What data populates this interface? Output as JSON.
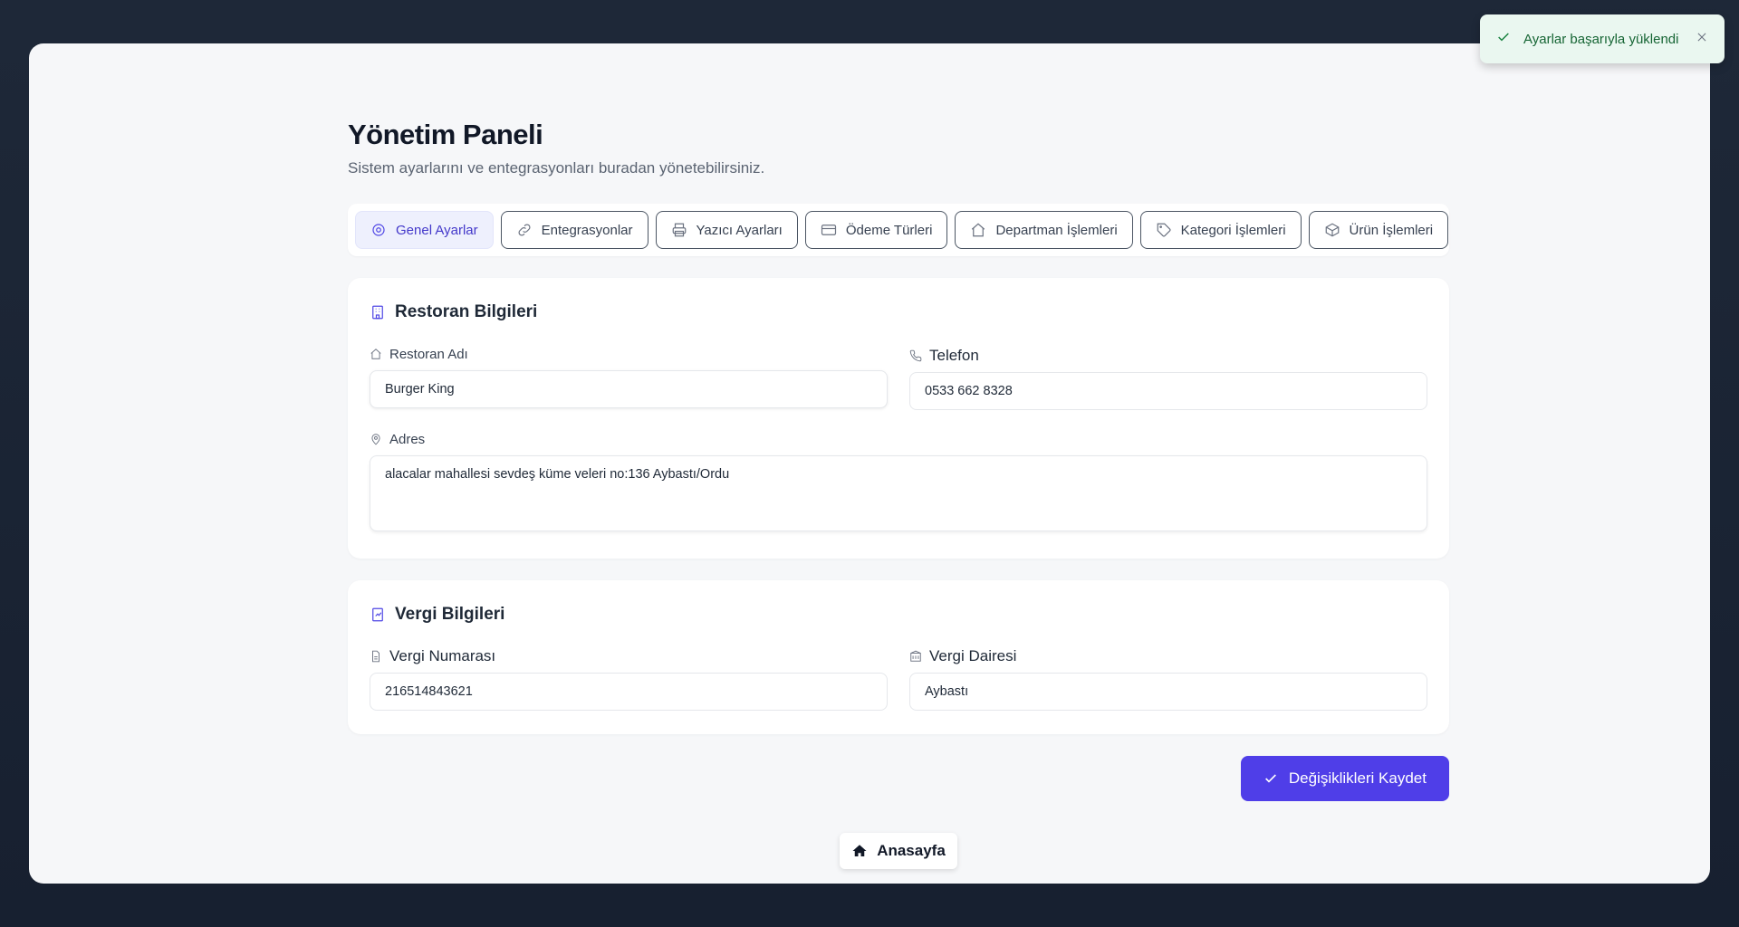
{
  "header": {
    "title": "Yönetim Paneli",
    "subtitle": "Sistem ayarlarını ve entegrasyonları buradan yönetebilirsiniz."
  },
  "tabs": [
    {
      "label": "Genel Ayarlar",
      "icon": "gear-icon",
      "active": true
    },
    {
      "label": "Entegrasyonlar",
      "icon": "link-icon",
      "active": false
    },
    {
      "label": "Yazıcı Ayarları",
      "icon": "printer-icon",
      "active": false
    },
    {
      "label": "Ödeme Türleri",
      "icon": "credit-card-icon",
      "active": false
    },
    {
      "label": "Departman İşlemleri",
      "icon": "home-icon",
      "active": false
    },
    {
      "label": "Kategori İşlemleri",
      "icon": "tag-icon",
      "active": false
    },
    {
      "label": "Ürün İşlemleri",
      "icon": "box-icon",
      "active": false
    }
  ],
  "restaurant": {
    "title": "Restoran Bilgileri",
    "name_label": "Restoran Adı",
    "name_value": "Burger King",
    "phone_label": "Telefon",
    "phone_value": "0533 662 8328",
    "address_label": "Adres",
    "address_value": "alacalar mahallesi sevdeş küme veleri no:136 Aybastı/Ordu"
  },
  "tax": {
    "title": "Vergi Bilgileri",
    "number_label": "Vergi Numarası",
    "number_value": "216514843621",
    "office_label": "Vergi Dairesi",
    "office_value": "Aybastı"
  },
  "actions": {
    "save_label": "Değişiklikleri Kaydet",
    "home_label": "Anasayfa"
  },
  "toast": {
    "message": "Ayarlar başarıyla yüklendi",
    "status": "success"
  },
  "colors": {
    "accent": "#4f3ee8",
    "background": "#1b2433",
    "panel": "#f6f7f9",
    "toast_bg": "#eaf7f0"
  }
}
